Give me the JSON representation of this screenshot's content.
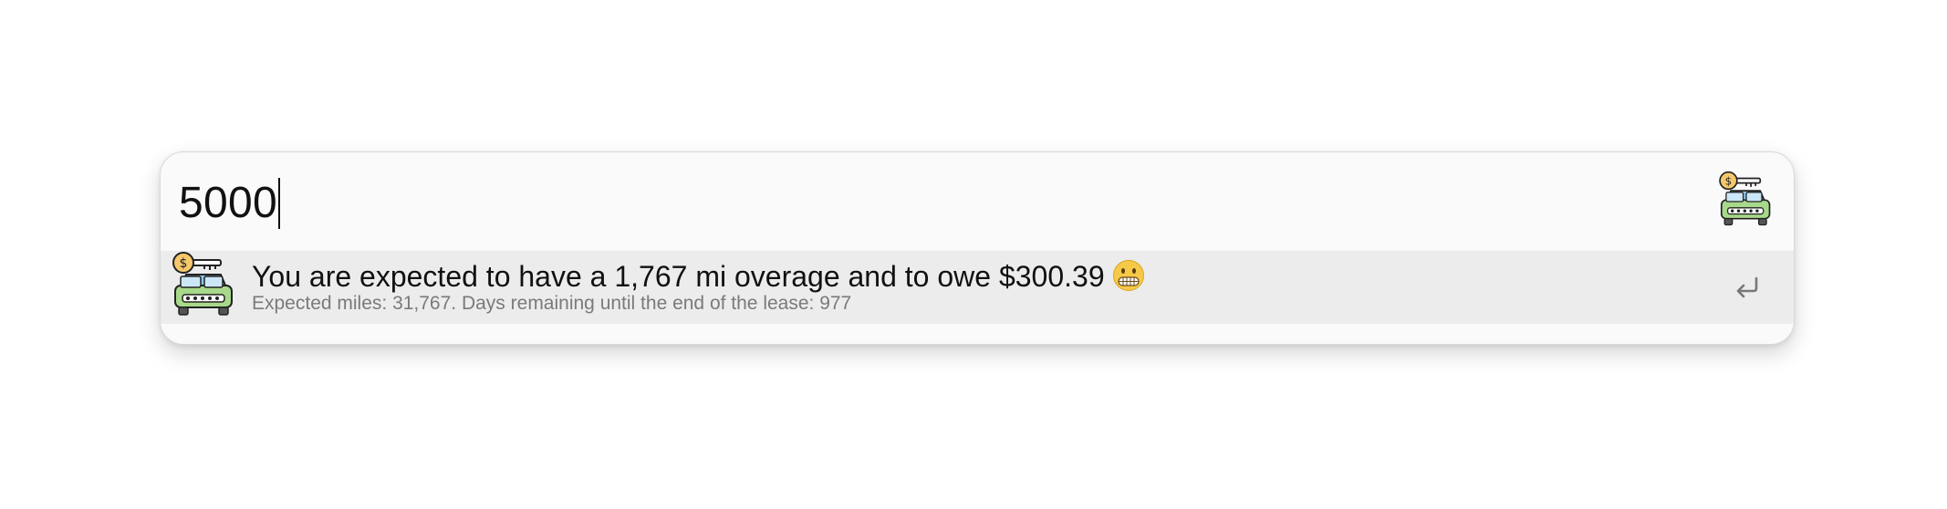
{
  "query": {
    "value": "5000"
  },
  "header_icon": "car-lease-dollar-key-icon",
  "result": {
    "icon": "car-lease-dollar-key-icon",
    "title": "You are expected to have a 1,767 mi overage and to owe $300.39",
    "emoji": "grimacing-face-emoji",
    "subtitle": "Expected miles: 31,767. Days remaining until the end of the lease: 977",
    "action_icon": "enter-return-icon"
  },
  "colors": {
    "panel_bg": "#fafafa",
    "selected_row_bg": "#ececec",
    "subtitle_text": "#7a7a7a",
    "car_body": "#a8d98a",
    "coin": "#f5c86b"
  }
}
